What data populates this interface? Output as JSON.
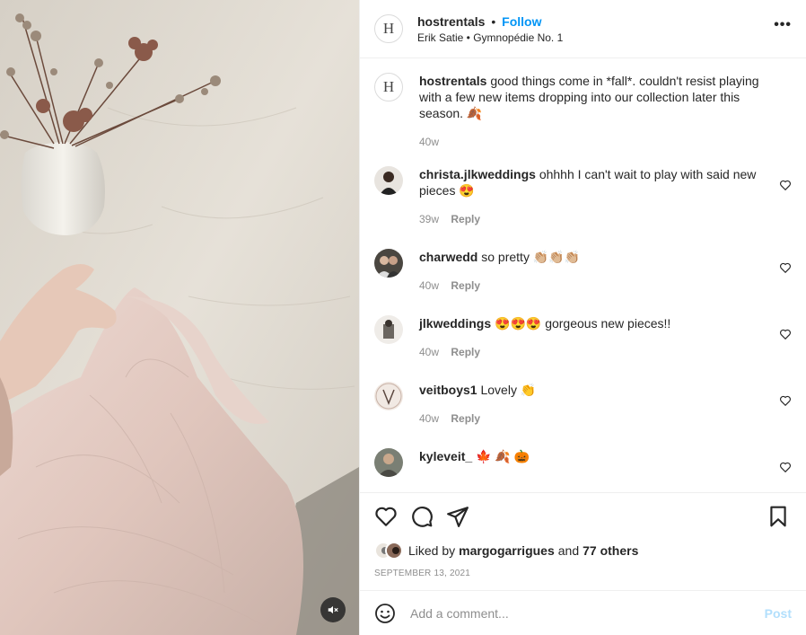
{
  "header": {
    "username": "hostrentals",
    "separator": "•",
    "follow_label": "Follow",
    "audio": "Erik Satie • Gymnopédie No. 1",
    "avatar_letter": "H",
    "more_label": "•••"
  },
  "caption": {
    "username": "hostrentals",
    "text": "good things come in *fall*. couldn't resist playing with a few new items dropping into our collection later this season. 🍂",
    "age": "40w",
    "avatar_letter": "H"
  },
  "comments": [
    {
      "username": "christa.jlkweddings",
      "text": "ohhhh I can't wait to play with said new pieces 😍",
      "age": "39w",
      "reply_label": "Reply"
    },
    {
      "username": "charwedd",
      "text": "so pretty 👏🏼👏🏼👏🏼",
      "age": "40w",
      "reply_label": "Reply"
    },
    {
      "username": "jlkweddings",
      "text": "😍😍😍 gorgeous new pieces!!",
      "age": "40w",
      "reply_label": "Reply"
    },
    {
      "username": "veitboys1",
      "text": "Lovely 👏",
      "age": "40w",
      "reply_label": "Reply"
    },
    {
      "username": "kyleveit_",
      "text": "🍁 🍂 🎃",
      "age": "",
      "reply_label": ""
    }
  ],
  "likes": {
    "prefix": "Liked by",
    "user": "margogarrigues",
    "joiner": "and",
    "others": "77 others"
  },
  "date": "SEPTEMBER 13, 2021",
  "add_comment": {
    "placeholder": "Add a comment...",
    "post_label": "Post"
  },
  "colors": {
    "accent": "#0095f6",
    "post_disabled": "#b2dffc",
    "muted": "#8e8e8e"
  },
  "icons": [
    "heart-icon",
    "comment-icon",
    "share-icon",
    "bookmark-icon",
    "emoji-icon",
    "mute-icon"
  ]
}
